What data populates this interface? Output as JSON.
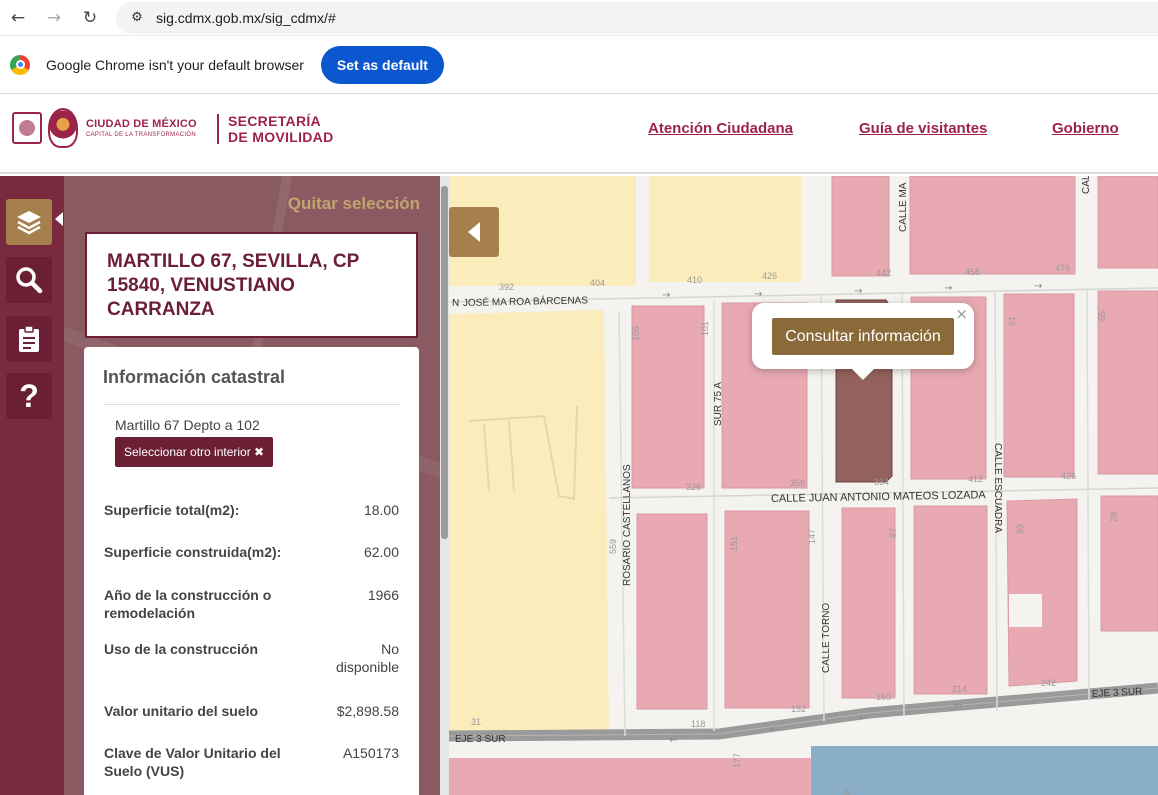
{
  "browser": {
    "url": "sig.cdmx.gob.mx/sig_cdmx/#",
    "back_icon": "←",
    "forward_icon": "→",
    "reload_icon": "↻",
    "infobar_text": "Google Chrome isn't your default browser",
    "set_default_label": "Set as default"
  },
  "header": {
    "logo_main": "CIUDAD DE MÉXICO",
    "logo_sub": "CAPITAL DE LA TRANSFORMACIÓN",
    "secretaria_line1": "SECRETARÍA",
    "secretaria_line2": "DE MOVILIDAD",
    "links": [
      "Atención Ciudadana",
      "Guía de visitantes",
      "Gobierno"
    ]
  },
  "panel": {
    "quitar_label": "Quitar selección",
    "address": "MARTILLO 67, SEVILLA, CP 15840, VENUSTIANO CARRANZA",
    "info_title": "Información catastral",
    "unit_label": "Martillo 67 Depto a 102",
    "select_other_label": "Seleccionar otro interior ✖",
    "attributes": [
      {
        "label": "Superficie total(m2):",
        "value": "18.00"
      },
      {
        "label": "Superficie construida(m2):",
        "value": "62.00"
      },
      {
        "label": "Año de la construcción o remodelación",
        "value": "1966"
      },
      {
        "label": "Uso de la construcción",
        "value": "No disponible"
      },
      {
        "label": "Valor unitario del suelo",
        "value": "$2,898.58"
      },
      {
        "label": "Clave de Valor Unitario del Suelo (VUS)",
        "value": "A150173"
      }
    ]
  },
  "map": {
    "popup_button": "Consultar información",
    "popup_close": "×",
    "streets": {
      "roa_barcenas": "JOSÉ MA ROA BÁRCENAS",
      "roa_prefix": "N",
      "mateos_lozada": "CALLE JUAN ANTONIO MATEOS LOZADA",
      "sur75a": "SUR 75 A",
      "rosario": "ROSARIO CASTELLANOS",
      "torno": "CALLE TORNO",
      "escuadra": "CALLE ESCUADRA",
      "eje3_right": "EJE 3 SUR",
      "eje3_left": "EJE 3 SUR",
      "calle_ma": "CALLE MA",
      "cal_top": "CAL"
    },
    "numbers": [
      "392",
      "404",
      "410",
      "426",
      "442",
      "456",
      "476",
      "101",
      "105",
      "75",
      "61",
      "65",
      "326",
      "358",
      "364",
      "412",
      "426",
      "559",
      "151",
      "147",
      "87",
      "93",
      "28",
      "160",
      "214",
      "242",
      "152",
      "118",
      "31",
      "177",
      "39"
    ]
  }
}
